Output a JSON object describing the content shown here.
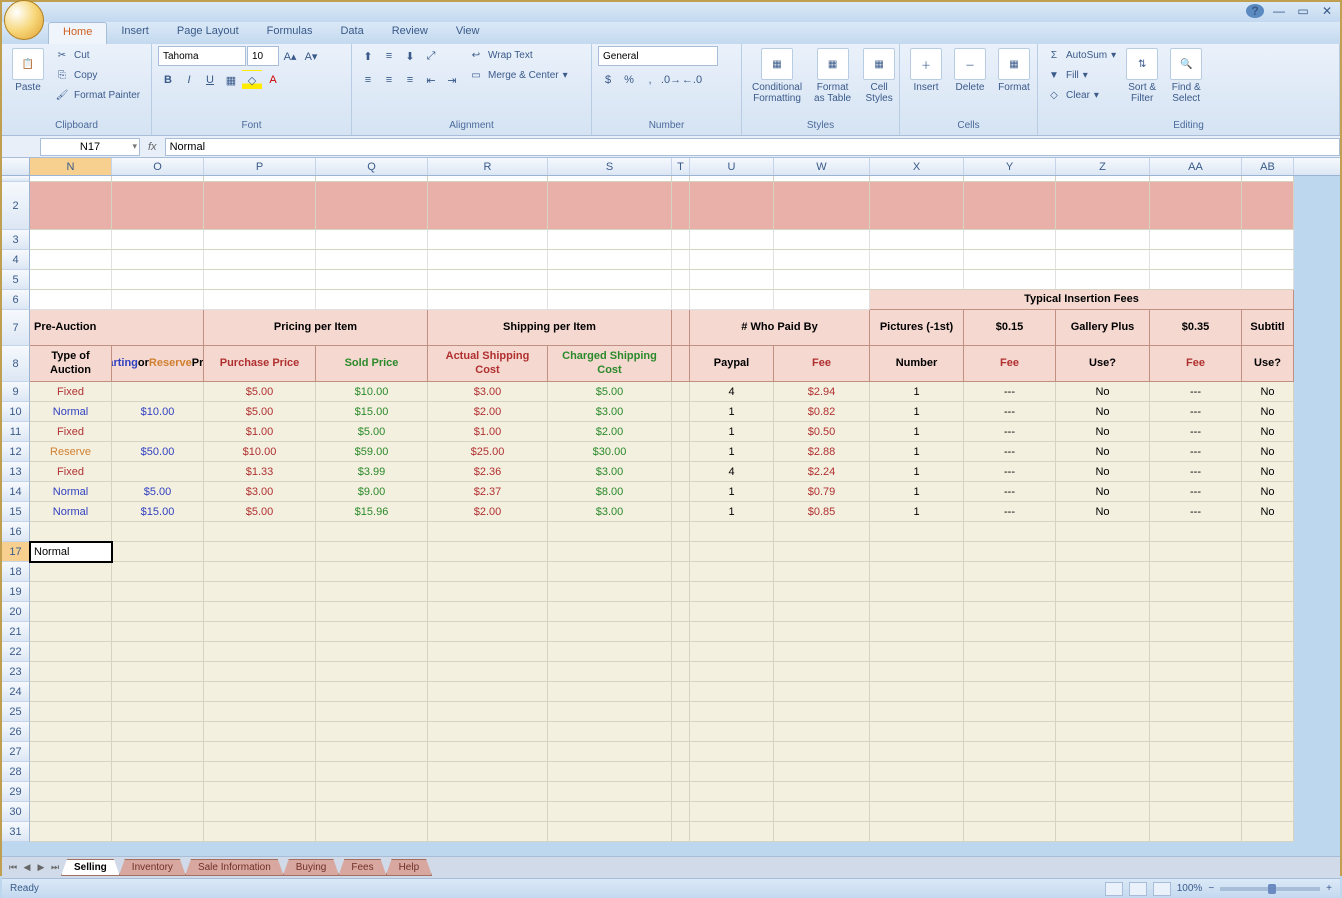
{
  "titlebar": {
    "help": "?"
  },
  "tabs": [
    "Home",
    "Insert",
    "Page Layout",
    "Formulas",
    "Data",
    "Review",
    "View"
  ],
  "activeTab": "Home",
  "ribbon": {
    "clipboard": {
      "paste": "Paste",
      "cut": "Cut",
      "copy": "Copy",
      "fmtPainter": "Format Painter",
      "label": "Clipboard"
    },
    "font": {
      "name": "Tahoma",
      "size": "10",
      "label": "Font",
      "bold": "B",
      "italic": "I",
      "underline": "U"
    },
    "alignment": {
      "wrap": "Wrap Text",
      "merge": "Merge & Center",
      "label": "Alignment"
    },
    "number": {
      "fmt": "General",
      "label": "Number"
    },
    "styles": {
      "cond": "Conditional\nFormatting",
      "fmtTable": "Format\nas Table",
      "cellStyles": "Cell\nStyles",
      "label": "Styles"
    },
    "cells": {
      "insert": "Insert",
      "delete": "Delete",
      "format": "Format",
      "label": "Cells"
    },
    "editing": {
      "autosum": "AutoSum",
      "fill": "Fill",
      "clear": "Clear",
      "sort": "Sort &\nFilter",
      "find": "Find &\nSelect",
      "label": "Editing"
    }
  },
  "namebox": "N17",
  "formulaLabel": "fx",
  "formulaValue": "Normal",
  "columns": [
    "N",
    "O",
    "P",
    "Q",
    "R",
    "S",
    "T",
    "U",
    "W",
    "X",
    "Y",
    "Z",
    "AA",
    "AB"
  ],
  "headers1": {
    "preAuction": "Pre-Auction",
    "pricing": "Pricing per Item",
    "shipping": "Shipping per Item",
    "paidBy": "# Who Paid By",
    "pictures": "Pictures (-1st)",
    "fee015": "$0.15",
    "gallery": "Gallery Plus",
    "fee035": "$0.35",
    "subtitle": "Subtitl",
    "typicalFees": "Typical Insertion Fees"
  },
  "headers2": {
    "type": "Type of Auction",
    "starting": "Starting or Reserve Price",
    "purchase": "Purchase Price",
    "sold": "Sold Price",
    "actualShip": "Actual Shipping Cost",
    "chargedShip": "Charged Shipping Cost",
    "paypal": "Paypal",
    "fee": "Fee",
    "number": "Number",
    "feeLbl": "Fee",
    "use": "Use?",
    "feeLbl2": "Fee",
    "use2": "Use?"
  },
  "rows": [
    {
      "n": "9",
      "type": "Fixed",
      "typeColor": "#b03030",
      "start": "",
      "purchase": "$5.00",
      "sold": "$10.00",
      "aship": "$3.00",
      "cship": "$5.00",
      "paypal": "4",
      "fee": "$2.94",
      "num": "1",
      "f015": "---",
      "gal": "No",
      "f035": "---",
      "sub": "No"
    },
    {
      "n": "10",
      "type": "Normal",
      "typeColor": "#3040c0",
      "start": "$10.00",
      "purchase": "$5.00",
      "sold": "$15.00",
      "aship": "$2.00",
      "cship": "$3.00",
      "paypal": "1",
      "fee": "$0.82",
      "num": "1",
      "f015": "---",
      "gal": "No",
      "f035": "---",
      "sub": "No"
    },
    {
      "n": "11",
      "type": "Fixed",
      "typeColor": "#b03030",
      "start": "",
      "purchase": "$1.00",
      "sold": "$5.00",
      "aship": "$1.00",
      "cship": "$2.00",
      "paypal": "1",
      "fee": "$0.50",
      "num": "1",
      "f015": "---",
      "gal": "No",
      "f035": "---",
      "sub": "No"
    },
    {
      "n": "12",
      "type": "Reserve",
      "typeColor": "#d08030",
      "start": "$50.00",
      "purchase": "$10.00",
      "sold": "$59.00",
      "aship": "$25.00",
      "cship": "$30.00",
      "paypal": "1",
      "fee": "$2.88",
      "num": "1",
      "f015": "---",
      "gal": "No",
      "f035": "---",
      "sub": "No"
    },
    {
      "n": "13",
      "type": "Fixed",
      "typeColor": "#b03030",
      "start": "",
      "purchase": "$1.33",
      "sold": "$3.99",
      "aship": "$2.36",
      "cship": "$3.00",
      "paypal": "4",
      "fee": "$2.24",
      "num": "1",
      "f015": "---",
      "gal": "No",
      "f035": "---",
      "sub": "No"
    },
    {
      "n": "14",
      "type": "Normal",
      "typeColor": "#3040c0",
      "start": "$5.00",
      "purchase": "$3.00",
      "sold": "$9.00",
      "aship": "$2.37",
      "cship": "$8.00",
      "paypal": "1",
      "fee": "$0.79",
      "num": "1",
      "f015": "---",
      "gal": "No",
      "f035": "---",
      "sub": "No"
    },
    {
      "n": "15",
      "type": "Normal",
      "typeColor": "#3040c0",
      "start": "$15.00",
      "purchase": "$5.00",
      "sold": "$15.96",
      "aship": "$2.00",
      "cship": "$3.00",
      "paypal": "1",
      "fee": "$0.85",
      "num": "1",
      "f015": "---",
      "gal": "No",
      "f035": "---",
      "sub": "No"
    }
  ],
  "selectedRow": "17",
  "selectedCell": "Normal",
  "emptyRowNums": [
    "16",
    "17",
    "18",
    "19",
    "20",
    "21",
    "22",
    "23",
    "24",
    "25",
    "26",
    "27",
    "28",
    "29",
    "30",
    "31"
  ],
  "sheetTabs": [
    "Selling",
    "Inventory",
    "Sale Information",
    "Buying",
    "Fees",
    "Help"
  ],
  "activeSheet": "Selling",
  "status": {
    "ready": "Ready",
    "zoom": "100%"
  }
}
